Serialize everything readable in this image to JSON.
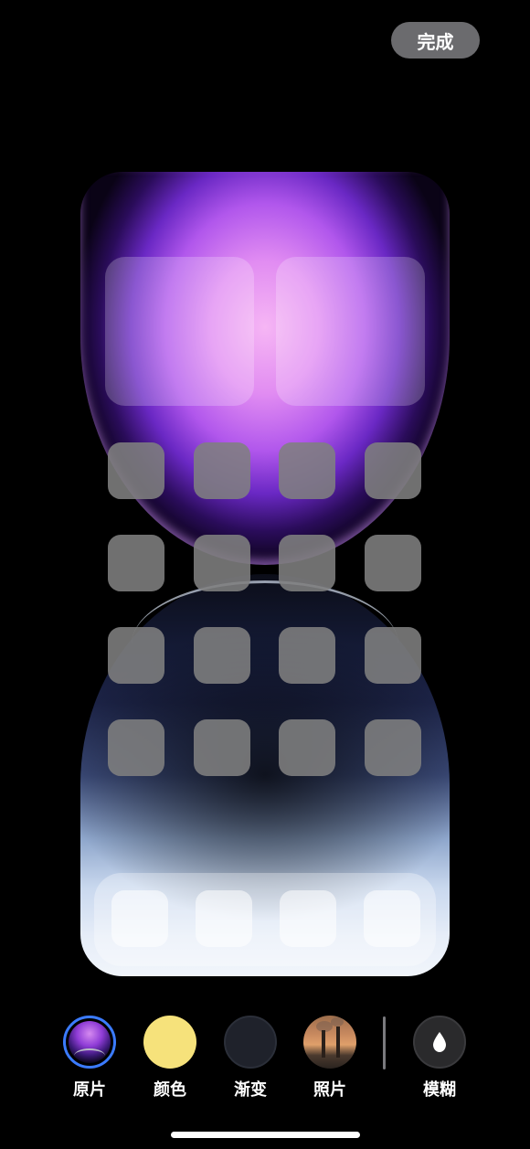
{
  "header": {
    "done_label": "完成"
  },
  "preview": {
    "widgets": 2,
    "app_rows": 4,
    "app_cols": 4,
    "dock_apps": 4
  },
  "options": [
    {
      "label": "原片",
      "icon": "original-wallpaper-swatch",
      "selected": true
    },
    {
      "label": "颜色",
      "icon": "yellow-color-swatch",
      "color": "#f6e27b"
    },
    {
      "label": "渐变",
      "icon": "dark-gradient-swatch",
      "color": "#1f222b"
    },
    {
      "label": "照片",
      "icon": "photo-swatch"
    },
    {
      "label": "模糊",
      "icon": "droplet-icon"
    }
  ],
  "colors": {
    "accent": "#3b7bff",
    "done_bg": "#6b6b6e"
  }
}
